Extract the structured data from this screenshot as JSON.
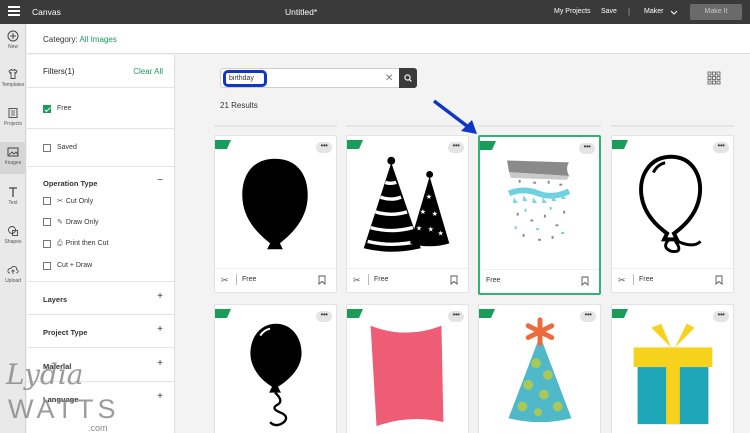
{
  "topbar": {
    "app_name": "Canvas",
    "doc_title": "Untitled*",
    "my_projects": "My Projects",
    "save": "Save",
    "separator": "|",
    "machine": "Maker",
    "make_it": "Make It"
  },
  "rail": {
    "items": [
      {
        "label": "New",
        "icon": "plus-circle-icon"
      },
      {
        "label": "Templates",
        "icon": "shirt-icon"
      },
      {
        "label": "Projects",
        "icon": "projects-icon"
      },
      {
        "label": "Images",
        "icon": "image-icon"
      },
      {
        "label": "Text",
        "icon": "text-icon"
      },
      {
        "label": "Shapes",
        "icon": "shapes-icon"
      },
      {
        "label": "Upload",
        "icon": "upload-icon"
      }
    ],
    "active": "Images"
  },
  "category": {
    "label": "Category:",
    "value": "All Images"
  },
  "filters": {
    "title": "Filters(1)",
    "clear_all": "Clear All",
    "free": {
      "label": "Free",
      "checked": true
    },
    "saved": {
      "label": "Saved",
      "checked": false
    },
    "operation_type": {
      "title": "Operation Type",
      "toggle": "−",
      "options": [
        {
          "label": "Cut Only",
          "icon": "scissors-icon"
        },
        {
          "label": "Draw Only",
          "icon": "pen-icon"
        },
        {
          "label": "Print then Cut",
          "icon": "printer-icon"
        },
        {
          "label": "Cut + Draw",
          "icon": ""
        }
      ]
    },
    "layers": {
      "title": "Layers",
      "toggle": "+"
    },
    "project_type": {
      "title": "Project Type",
      "toggle": "+"
    },
    "material": {
      "title": "Material",
      "toggle": "+"
    },
    "language": {
      "title": "Language",
      "toggle": "+"
    }
  },
  "watermark": {
    "line1": "Lydia",
    "line2": "WATTS",
    "line3": ".com"
  },
  "search": {
    "query": "birthday",
    "clear": "✕"
  },
  "results_text": "21 Results",
  "cards": {
    "row1": [
      {
        "name": "balloon-silhouette",
        "free": "Free",
        "selected": false
      },
      {
        "name": "striped-party-hats",
        "free": "Free",
        "selected": false
      },
      {
        "name": "confetti-banner",
        "free": "Free",
        "selected": true
      },
      {
        "name": "balloon-outline",
        "free": "Free",
        "selected": false
      }
    ],
    "row2": [
      {
        "name": "balloon-with-string"
      },
      {
        "name": "pink-banner-flag"
      },
      {
        "name": "polka-dot-party-hat"
      },
      {
        "name": "gift-box"
      }
    ],
    "more": "•••"
  },
  "colors": {
    "accent_green": "#1a9c5b",
    "selection_green": "#2eb574",
    "highlight_blue": "#1036c8",
    "topbar": "#3a3a3a"
  }
}
